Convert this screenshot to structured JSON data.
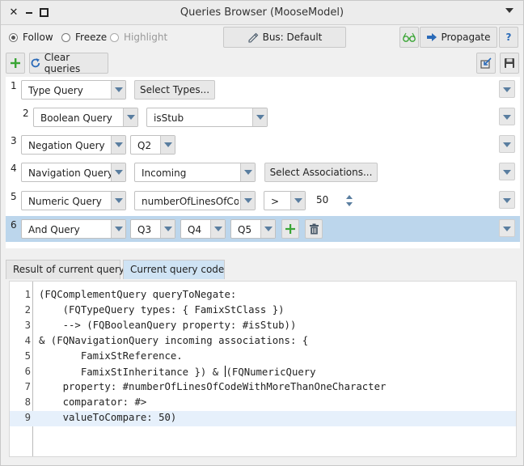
{
  "window": {
    "title": "Queries Browser (MooseModel)"
  },
  "toolbar": {
    "radios": [
      {
        "label": "Follow",
        "checked": true,
        "enabled": true
      },
      {
        "label": "Freeze",
        "checked": false,
        "enabled": true
      },
      {
        "label": "Highlight",
        "checked": false,
        "enabled": false
      }
    ],
    "bus_label": "Bus: Default",
    "propagate_label": "Propagate",
    "help_label": "?",
    "clear_label": "Clear queries"
  },
  "queries": [
    {
      "num": "1",
      "type": "Type Query",
      "extra_button": "Select Types..."
    },
    {
      "num": "2",
      "type": "Boolean Query",
      "property": "isStub"
    },
    {
      "num": "3",
      "type": "Negation Query",
      "operand": "Q2"
    },
    {
      "num": "4",
      "type": "Navigation Query",
      "direction": "Incoming",
      "extra_button": "Select Associations..."
    },
    {
      "num": "5",
      "type": "Numeric Query",
      "property": "numberOfLinesOfCode",
      "comparator": ">",
      "value": "50"
    },
    {
      "num": "6",
      "type": "And Query",
      "operands": [
        "Q3",
        "Q4",
        "Q5"
      ],
      "selected": true
    }
  ],
  "tabs": [
    {
      "label": "Result of current query",
      "active": false
    },
    {
      "label": "Current query code",
      "active": true
    }
  ],
  "code": {
    "current_line": 9,
    "lines": [
      {
        "n": "1",
        "text": "(FQComplementQuery queryToNegate:"
      },
      {
        "n": "2",
        "text": "    (FQTypeQuery types: { FamixStClass })"
      },
      {
        "n": "3",
        "text": "    --> (FQBooleanQuery property: #isStub))"
      },
      {
        "n": "4",
        "text": "& (FQNavigationQuery incoming associations: {"
      },
      {
        "n": "5",
        "text": "       FamixStReference."
      },
      {
        "n": "6a",
        "text": "       FamixStInheritance }) & "
      },
      {
        "n": "6b",
        "text": "(FQNumericQuery"
      },
      {
        "n": "7",
        "text": "    property: #numberOfLinesOfCodeWithMoreThanOneCharacter"
      },
      {
        "n": "8",
        "text": "    comparator: #>"
      },
      {
        "n": "9",
        "text": "    valueToCompare: 50)"
      }
    ],
    "numbers": [
      "1",
      "2",
      "3",
      "4",
      "5",
      "6",
      "7",
      "8",
      "9"
    ]
  },
  "colors": {
    "selection": "#bcd6ec",
    "add_green": "#3aa535",
    "arrow_blue": "#5a7ea0"
  }
}
